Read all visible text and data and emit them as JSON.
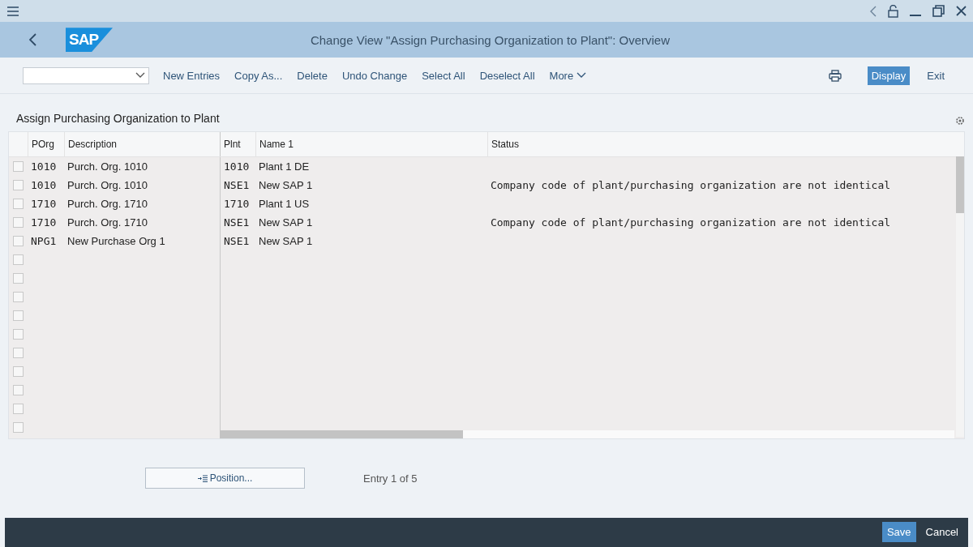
{
  "header": {
    "logo": "SAP",
    "title": "Change View \"Assign Purchasing Organization to Plant\": Overview"
  },
  "toolbar": {
    "actions": [
      {
        "label": "New Entries",
        "kind": "plain"
      },
      {
        "label": "Copy As...",
        "kind": "plain"
      },
      {
        "label": "Delete",
        "kind": "plain"
      },
      {
        "label": "Undo Change",
        "kind": "plain"
      },
      {
        "label": "Select All",
        "kind": "plain"
      },
      {
        "label": "Deselect All",
        "kind": "plain"
      },
      {
        "label": "More",
        "kind": "menu"
      }
    ],
    "right_actions": [
      {
        "label": "Display",
        "kind": "emphasized"
      },
      {
        "label": "Exit",
        "kind": "plain"
      }
    ]
  },
  "section": {
    "title": "Assign Purchasing Organization to Plant"
  },
  "table": {
    "columns": [
      "POrg",
      "Description",
      "Plnt",
      "Name 1",
      "Status"
    ],
    "rows": [
      {
        "checked": false,
        "porg": "1010",
        "description": "Purch. Org. 1010",
        "plnt": "1010",
        "name": "Plant 1 DE"
      },
      {
        "checked": false,
        "porg": "1010",
        "description": "Purch. Org. 1010",
        "plnt": "NSE1",
        "name": "New SAP 1",
        "status": "Company code of plant/purchasing organization are not identical"
      },
      {
        "checked": false,
        "porg": "1710",
        "description": "Purch. Org. 1710",
        "plnt": "1710",
        "name": "Plant 1 US"
      },
      {
        "checked": false,
        "porg": "1710",
        "description": "Purch. Org. 1710",
        "plnt": "NSE1",
        "name": "New SAP 1",
        "status": "Company code of plant/purchasing organization are not identical"
      },
      {
        "checked": false,
        "porg": "NPG1",
        "description": "New Purchase Org 1",
        "plnt": "NSE1",
        "name": "New SAP 1"
      }
    ],
    "empty_rows": [
      {
        "checked": false
      },
      {
        "checked": false
      },
      {
        "checked": false
      },
      {
        "checked": false
      },
      {
        "checked": false
      },
      {
        "checked": false
      },
      {
        "checked": false
      },
      {
        "checked": false
      },
      {
        "checked": false
      },
      {
        "checked": false
      }
    ]
  },
  "position_button": "Position...",
  "entry_info": "Entry 1 of 5",
  "footer": {
    "actions": [
      {
        "label": "Save",
        "kind": "emphasized"
      },
      {
        "label": "Cancel",
        "kind": "plain"
      }
    ]
  }
}
